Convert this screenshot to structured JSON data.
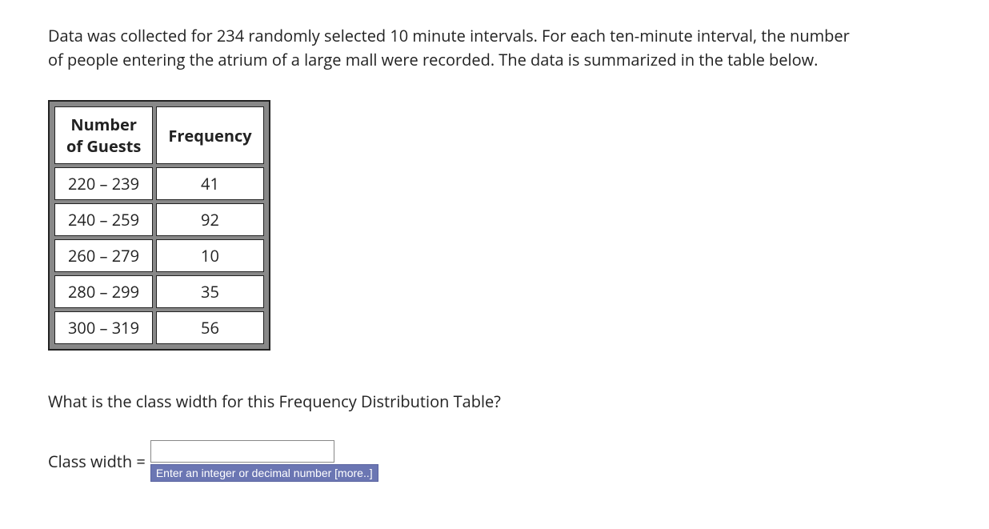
{
  "problem": "Data was collected for 234 randomly selected 10 minute intervals. For each ten-minute interval, the number of people entering the atrium of a large mall were recorded. The data is summarized in the table below.",
  "table": {
    "headers": {
      "col1_line1": "Number",
      "col1_line2": "of Guests",
      "col2": "Frequency"
    },
    "rows": [
      {
        "range": "220 – 239",
        "freq": "41"
      },
      {
        "range": "240 – 259",
        "freq": "92"
      },
      {
        "range": "260 – 279",
        "freq": "10"
      },
      {
        "range": "280 – 299",
        "freq": "35"
      },
      {
        "range": "300 – 319",
        "freq": "56"
      }
    ]
  },
  "question": "What is the class width for this Frequency Distribution Table?",
  "answer_label": "Class width = ",
  "answer_value": "",
  "hint": "Enter an integer or decimal number [more..]"
}
